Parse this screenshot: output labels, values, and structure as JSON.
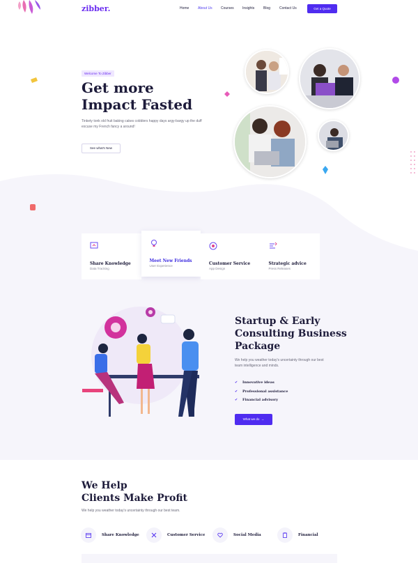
{
  "nav": {
    "logo": "zibber.",
    "links": [
      "Home",
      "About Us",
      "Courses",
      "Insights",
      "Blog",
      "Contact Us"
    ],
    "active": "About Us",
    "cta": "Get a Quote"
  },
  "hero": {
    "tag": "Welcome To Zibber",
    "title_line1": "Get more",
    "title_line2": "Impact Fasted",
    "text": "Tinkety tonk old fruit baking cakes cobblers happy days argy-bargy up the duff excuse my French fancy a around!",
    "button": "See what's New"
  },
  "features": [
    {
      "title": "Share Knowledge",
      "subtitle": "Data Tracking",
      "icon": "presentation-icon"
    },
    {
      "title": "Meet New Friends",
      "subtitle": "User Experience",
      "icon": "lightbulb-icon"
    },
    {
      "title": "Customer Service",
      "subtitle": "App Design",
      "icon": "service-icon"
    },
    {
      "title": "Strategic advice",
      "subtitle": "Press Releases",
      "icon": "strategy-icon"
    }
  ],
  "startup": {
    "title_line1": "Startup & Early",
    "title_line2": "Consulting Business",
    "title_line3": "Package",
    "text": "We help you weather today's uncertainty through our best team intelligence and minds.",
    "items": [
      "Innovative ideas",
      "Professional assistance",
      "Financial advisory"
    ],
    "button": "What we do"
  },
  "help": {
    "title_line1": "We Help",
    "title_line2": "Clients Make Profit",
    "text": "We help you weather today's uncertainty through our best team.",
    "services": [
      {
        "label": "Share Knowledge",
        "icon": "calendar-icon"
      },
      {
        "label": "Customer Service",
        "icon": "tools-icon"
      },
      {
        "label": "Social Media",
        "icon": "heart-icon"
      },
      {
        "label": "Financial",
        "icon": "clipboard-icon"
      }
    ]
  },
  "colors": {
    "primary": "#4f2cf0",
    "logo": "#6a2cf0",
    "dark": "#1d1b3a",
    "soft_bg": "#f6f5fb"
  }
}
